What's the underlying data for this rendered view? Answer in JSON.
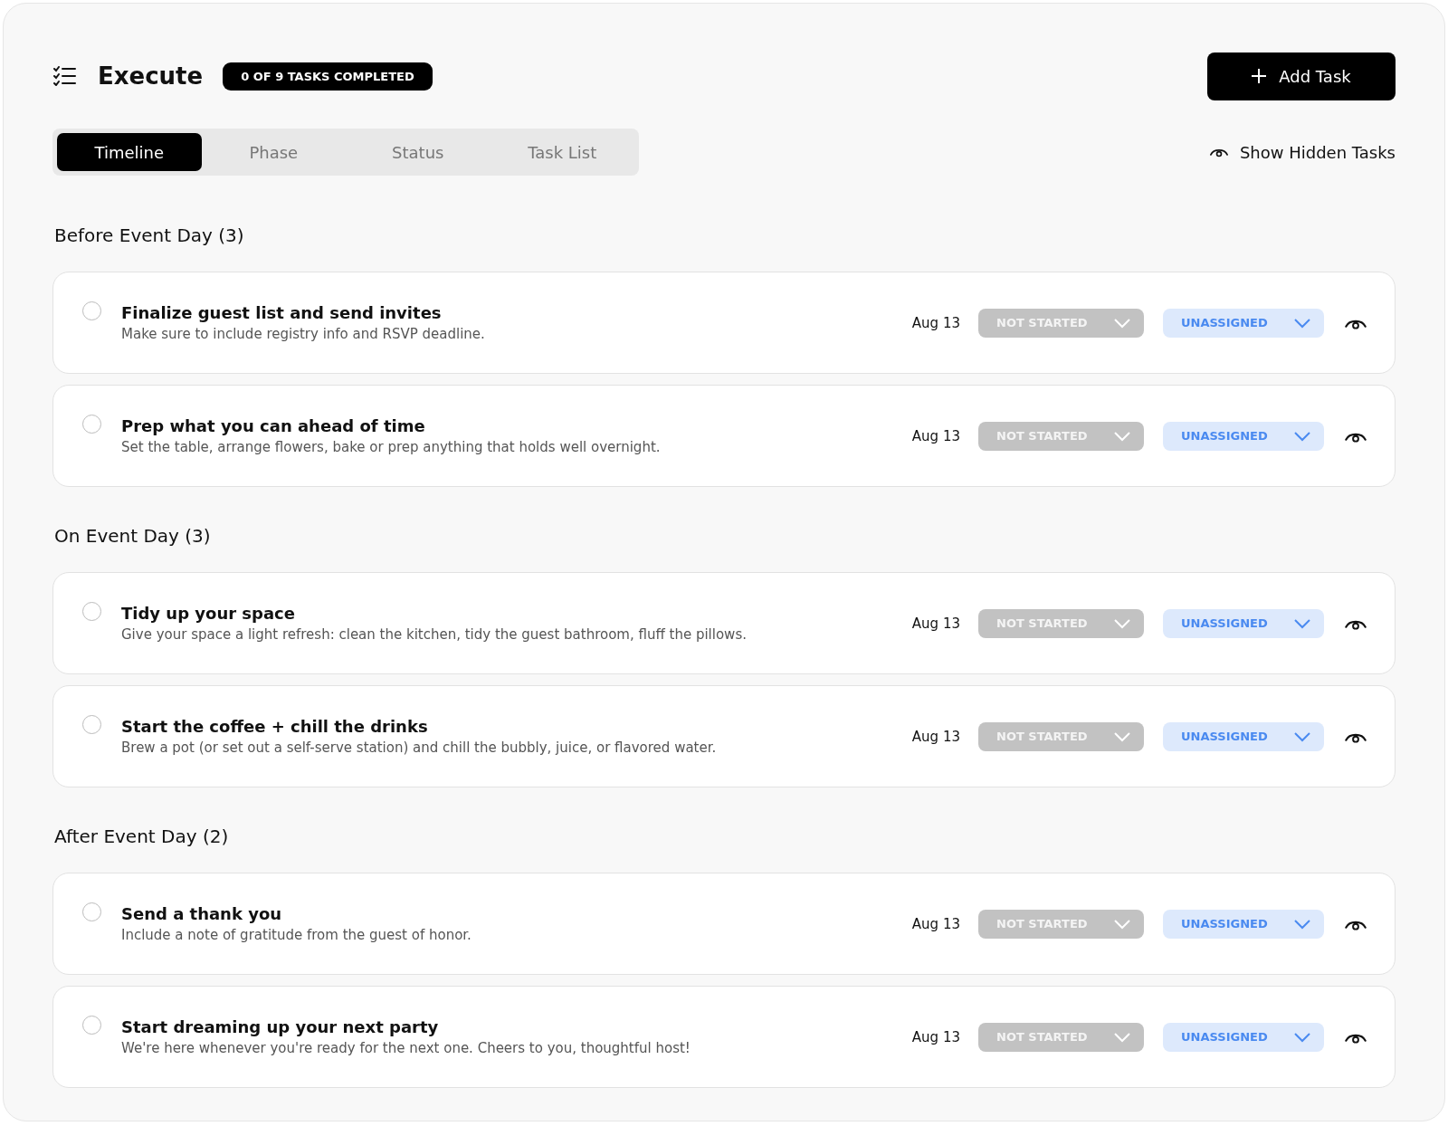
{
  "header": {
    "title": "Execute",
    "progress_badge": "0 OF 9 TASKS COMPLETED",
    "add_button": "Add Task"
  },
  "tabs": [
    {
      "label": "Timeline",
      "selected": true
    },
    {
      "label": "Phase",
      "selected": false
    },
    {
      "label": "Status",
      "selected": false
    },
    {
      "label": "Task List",
      "selected": false
    }
  ],
  "show_hidden": "Show Hidden Tasks",
  "sections": [
    {
      "title": "Before Event Day (3)",
      "tasks": [
        {
          "title": "Finalize guest list and send invites",
          "description": "Make sure to include registry info and RSVP deadline.",
          "date": "Aug 13",
          "status": "NOT STARTED",
          "assignee": "UNASSIGNED",
          "checked": false
        },
        {
          "title": "Prep what you can ahead of time",
          "description": "Set the table, arrange flowers, bake or prep anything that holds well overnight.",
          "date": "Aug 13",
          "status": "NOT STARTED",
          "assignee": "UNASSIGNED",
          "checked": false
        }
      ]
    },
    {
      "title": "On Event Day (3)",
      "tasks": [
        {
          "title": "Tidy up your space",
          "description": "Give your space a light refresh: clean the kitchen, tidy the guest bathroom, fluff the pillows.",
          "date": "Aug 13",
          "status": "NOT STARTED",
          "assignee": "UNASSIGNED",
          "checked": false
        },
        {
          "title": "Start the coffee + chill the drinks",
          "description": "Brew a pot (or set out a self-serve station) and chill the bubbly, juice, or flavored water.",
          "date": "Aug 13",
          "status": "NOT STARTED",
          "assignee": "UNASSIGNED",
          "checked": false
        }
      ]
    },
    {
      "title": "After Event Day (2)",
      "tasks": [
        {
          "title": "Send a thank you",
          "description": "Include a note of gratitude from the guest of honor.",
          "date": "Aug 13",
          "status": "NOT STARTED",
          "assignee": "UNASSIGNED",
          "checked": false
        },
        {
          "title": "Start dreaming up your next party",
          "description": "We're here whenever you're ready for the next one. Cheers to you, thoughtful host!",
          "date": "Aug 13",
          "status": "NOT STARTED",
          "assignee": "UNASSIGNED",
          "checked": false
        }
      ]
    }
  ]
}
